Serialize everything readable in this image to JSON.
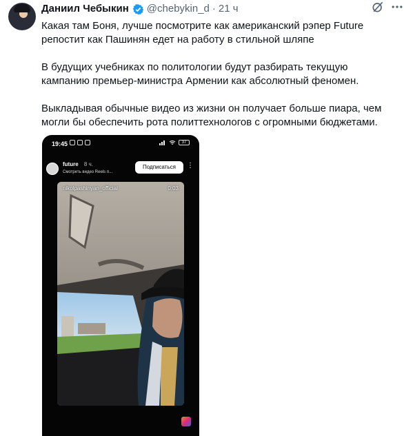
{
  "tweet": {
    "author_name": "Даниил Чебыкин",
    "handle": "@chebykin_d",
    "separator": "·",
    "time": "21 ч",
    "paragraphs": [
      "Какая там Боня, лучше посмотрите как американский рэпер Future репостит как Пашинян едет на работу в стильной шляпе",
      "В будущих учебниках по политологии будут разбирать текущую кампанию премьер-министра Армении как абсолютный феномен.",
      "Выкладывая обычные видео из жизни он получает больше пиара, чем могли бы обеспечить рота политтехнологов с огромными бюджетами."
    ]
  },
  "media": {
    "status_time": "19:45",
    "battery": "37",
    "story_user": "future",
    "story_age": "8 ч.",
    "story_sub": "Смотреть видео Reels п...",
    "subscribe_label": "Подписаться",
    "video_user": "nikolpashinyan_official",
    "video_time": "0:03"
  },
  "colors": {
    "verified": "#1d9bf0",
    "text": "#0f1419",
    "secondary": "#536471"
  },
  "icons": [
    "verified-icon",
    "grok-icon",
    "more-icon",
    "wifi-icon",
    "signal-icon",
    "battery-icon",
    "reels-icon"
  ]
}
